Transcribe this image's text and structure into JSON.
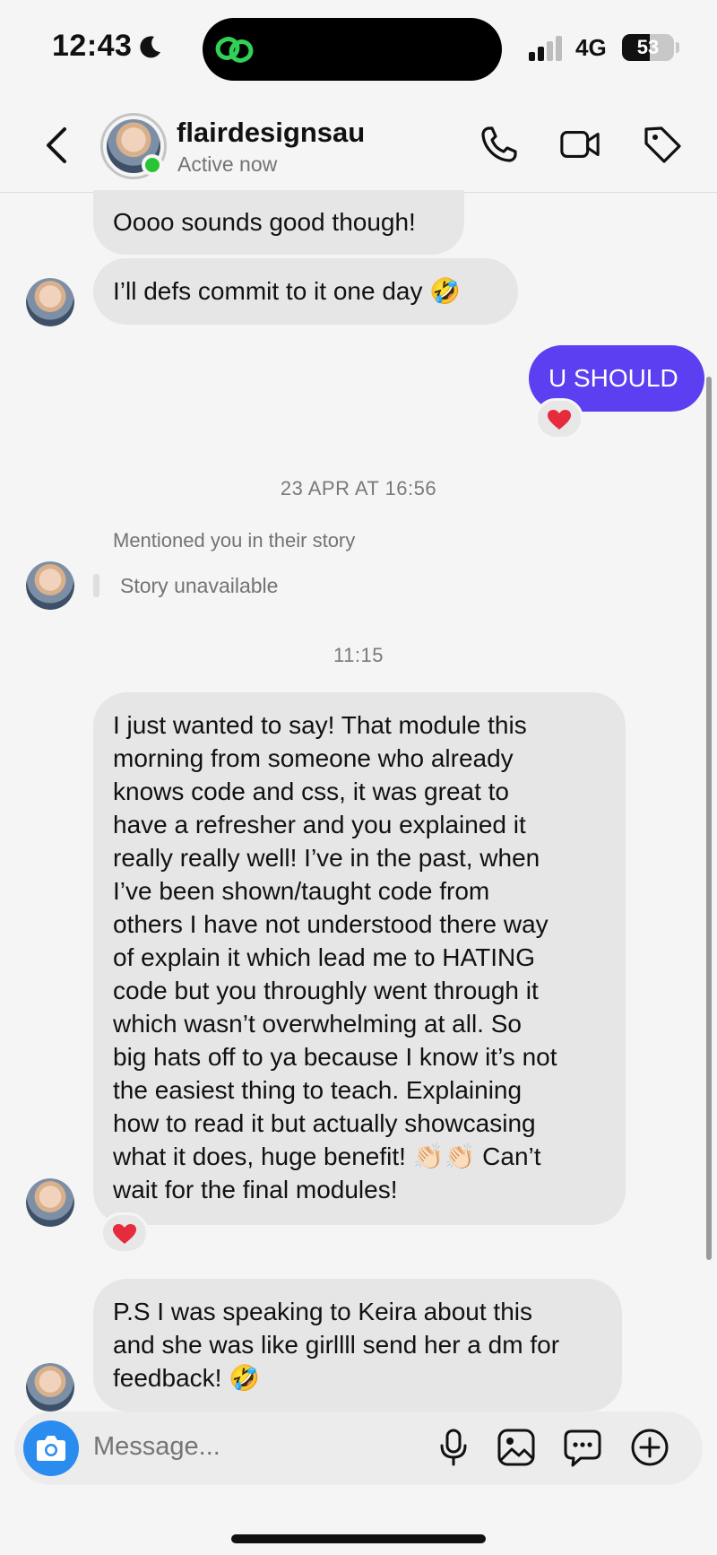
{
  "status_bar": {
    "time": "12:43",
    "network": "4G",
    "battery": "53",
    "battery_level": 0.53
  },
  "header": {
    "username": "flairdesignsau",
    "status": "Active now"
  },
  "messages": {
    "m1": "Oooo sounds good though!",
    "m2": "I’ll defs commit to it one day 🤣",
    "m3": "U SHOULD",
    "date1": "23 APR AT 16:56",
    "mention": "Mentioned you in their story",
    "story": "Story unavailable",
    "date2": "11:15",
    "m4": "I just wanted to say! That module this\nmorning from someone who already\nknows code and css, it was great to\nhave a refresher and you explained it\nreally really well! I’ve in the past, when\nI’ve been shown/taught code from\nothers I have not understood there way\nof explain it which lead me to HATING\ncode but you throughly went through it\nwhich wasn’t overwhelming at all. So\nbig hats off to ya because I know it’s not\nthe easiest thing to teach. Explaining\nhow to read it but actually showcasing\nwhat it does, huge benefit! 👏🏻👏🏻 Can’t\nwait for the final modules!",
    "m5": "P.S I was speaking to Keira about this\nand she was like girllll send her a dm for\nfeedback! 🤣"
  },
  "composer": {
    "placeholder": "Message..."
  },
  "icons": {
    "header": [
      "back-arrow-icon",
      "phone-icon",
      "video-camera-icon",
      "tag-icon"
    ],
    "composer": [
      "camera-icon",
      "microphone-icon",
      "gallery-icon",
      "sticker-icon",
      "plus-icon"
    ],
    "reaction": "heart-icon"
  },
  "colors": {
    "my_bubble": "#5b3ff0",
    "their_bubble": "#e6e6e6",
    "online": "#29c433",
    "camera_button": "#2b8cf0"
  }
}
